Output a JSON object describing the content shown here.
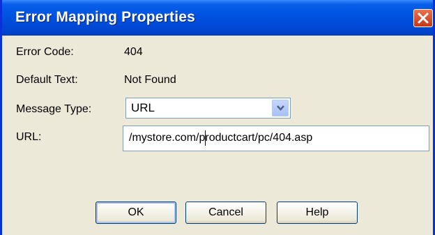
{
  "window": {
    "title": "Error Mapping Properties"
  },
  "icons": {
    "close": "close-icon",
    "dropdown": "chevron-down-icon"
  },
  "fields": {
    "error_code": {
      "label": "Error Code:",
      "value": "404"
    },
    "default_text": {
      "label": "Default Text:",
      "value": "Not Found"
    },
    "message_type": {
      "label": "Message Type:",
      "value": "URL"
    },
    "url": {
      "label": "URL:",
      "value": "/mystore.com/productcart/pc/404.asp"
    }
  },
  "buttons": {
    "ok": "OK",
    "cancel": "Cancel",
    "help": "Help"
  },
  "colors": {
    "titlebar": "#0054e3",
    "dialog_bg": "#ece9d8",
    "close": "#c73516"
  }
}
